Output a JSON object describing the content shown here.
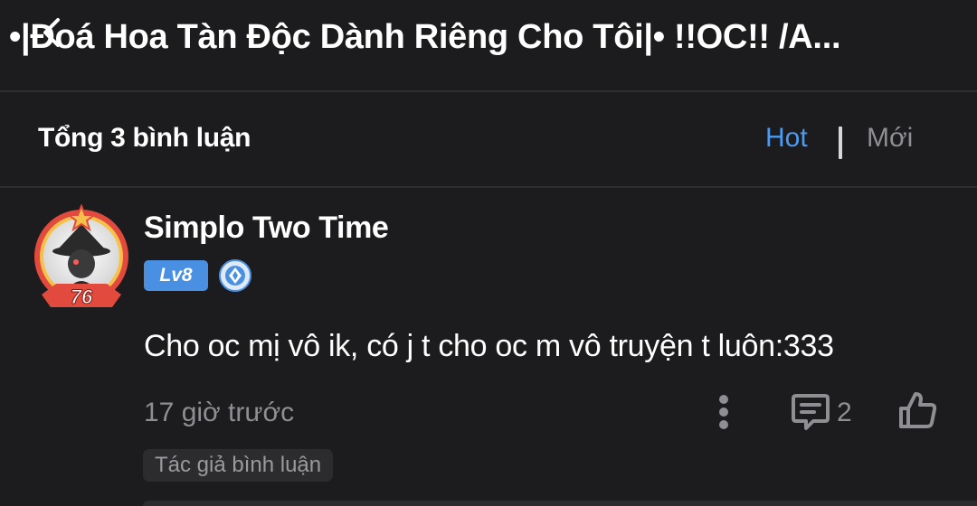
{
  "header": {
    "title": "•|Đoá Hoa Tàn Độc Dành Riêng Cho Tôi|• !!OC!! /A...",
    "back_icon": "back-chevron-icon"
  },
  "comments_bar": {
    "count_label": "Tổng 3 bình luận",
    "sort_hot": "Hot",
    "sort_new": "Mới",
    "active_sort": "Hot",
    "active_color": "#4d9bf0"
  },
  "comment": {
    "username": "Simplo Two Time",
    "avatar_frame_number": "76",
    "level": "Lv8",
    "rank_icon": "diamond-rank-icon",
    "text": "Cho oc mị vô ik, có j t cho oc m vô truyện t luôn:333",
    "time": "17 giờ trước",
    "reply_count": "2",
    "author_tag": "Tác giả bình luận"
  },
  "colors": {
    "background": "#1c1c1e",
    "accent": "#4a90e2",
    "muted": "#8e8e93"
  }
}
